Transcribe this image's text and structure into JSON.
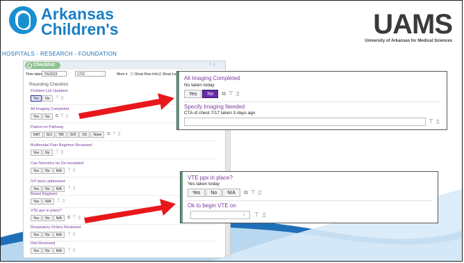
{
  "header": {
    "ach_line1": "Arkansas",
    "ach_line2": "Children's",
    "ach_tagline": "HOSPITALS - RESEARCH - FOUNDATION",
    "uams_title": "UAMS",
    "uams_subtitle": "University of Arkansas for Medical Sciences"
  },
  "checklist": {
    "title": "Checklist",
    "head_arrows": "↑ ↓",
    "toolbar": {
      "time_taken_label": "Time taken:",
      "date_value": "7/6/2023",
      "time_value": "1722",
      "more_label": "More ▾",
      "show_row_info": "Show Row Info",
      "show_last": "Show Last F"
    },
    "section_title": "Rounding Checklist",
    "items": [
      {
        "label": "Problem List Updated",
        "buttons": [
          "Yes",
          "No"
        ]
      },
      {
        "label": "All Imaging Completed",
        "buttons": [
          "Yes",
          "No"
        ]
      },
      {
        "label": "Patient on Pathway",
        "buttons": [
          "NAT",
          "SCI",
          "TBI",
          "SOI",
          "CK",
          "None"
        ]
      },
      {
        "label": "Multimodal Pain Regimen Reviewed",
        "buttons": [
          "Yes",
          "No"
        ]
      },
      {
        "label": "Can Narcotics be De-escalated",
        "buttons": [
          "Yes",
          "No",
          "N/A"
        ]
      },
      {
        "label": "IVF been addressed",
        "buttons": [
          "Yes",
          "No",
          "N/A"
        ]
      },
      {
        "label": "Bowel Regimen",
        "buttons": [
          "Yes",
          "N/A"
        ]
      },
      {
        "label": "VTE ppx in place?",
        "buttons": [
          "Yes",
          "No",
          "N/A"
        ]
      },
      {
        "label": "Respiratory Orders Reviewed",
        "buttons": [
          "Yes",
          "No",
          "N/A"
        ]
      },
      {
        "label": "Diet Reviewed",
        "buttons": [
          "Yes",
          "No",
          "N/A"
        ]
      }
    ]
  },
  "popup_imaging": {
    "title": "All Imaging Completed",
    "subtitle": "No taken today",
    "buttons": [
      "Yes",
      "No"
    ],
    "selected": "No",
    "specify_title": "Specify Imaging Needed",
    "specify_value": "CTA of chest 7/17 taken 3 days ago"
  },
  "popup_vte": {
    "title": "VTE ppx in place?",
    "subtitle": "Yes taken today",
    "buttons": [
      "Yes",
      "No",
      "N/A"
    ],
    "begin_title": "Ok to begin VTE on"
  },
  "colors": {
    "accent_purple": "#7a3a9e",
    "arrow_red": "#e8171b",
    "ach_blue": "#1a7fc4",
    "swoosh_blue": "#1f6fb8"
  },
  "icons": {
    "copy": "⧉",
    "filter": "⊤",
    "note": "🗋"
  }
}
